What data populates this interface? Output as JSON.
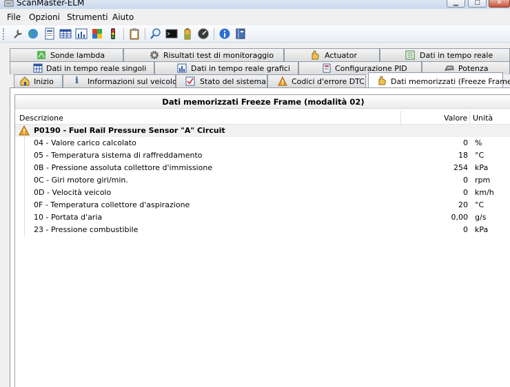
{
  "window": {
    "title": "ScanMaster-ELM"
  },
  "menu": [
    "File",
    "Opzioni",
    "Strumenti",
    "Aiuto"
  ],
  "toolbar_icons": [
    "wrench-icon",
    "globe-icon",
    "document-icon",
    "grid-icon",
    "bar-chart-icon",
    "colorful-window-icon",
    "traffic-light-icon",
    "clipboard-icon",
    "magnifier-icon",
    "terminal-icon",
    "battery-icon",
    "gauge-icon",
    "info-icon",
    "book-icon"
  ],
  "tabs": {
    "row1": [
      "Sonde lambda",
      "Risultati test di monitoraggio",
      "Actuator",
      "Dati in tempo reale"
    ],
    "row2": [
      "Dati in tempo reale singoli",
      "Dati in tempo reale grafici",
      "Configurazione PID",
      "Potenza"
    ],
    "row3": [
      "Inizio",
      "Informazioni sul veicolo",
      "Stato del sistema",
      "Codici d'errore DTC",
      "Dati memorizzati (Freeze Frame)"
    ]
  },
  "freeze_frame": {
    "title": "Dati memorizzati Freeze Frame (modalità 02)",
    "columns": {
      "description": "Descrizione",
      "value": "Valore",
      "unit": "Unità"
    },
    "dtc": "P0190 - Fuel Rail Pressure Sensor \"A\" Circuit",
    "rows": [
      {
        "desc": "04 - Valore carico calcolato",
        "value": "0",
        "unit": "%"
      },
      {
        "desc": "05 - Temperatura sistema di raffreddamento",
        "value": "18",
        "unit": "°C"
      },
      {
        "desc": "0B - Pressione assoluta collettore d'immissione",
        "value": "254",
        "unit": "kPa"
      },
      {
        "desc": "0C - Giri motore giri/min.",
        "value": "0",
        "unit": "rpm"
      },
      {
        "desc": "0D - Velocità veicolo",
        "value": "0",
        "unit": "km/h"
      },
      {
        "desc": "0F - Temperatura collettore d'aspirazione",
        "value": "20",
        "unit": "°C"
      },
      {
        "desc": "10 - Portata d'aria",
        "value": "0,00",
        "unit": "g/s"
      },
      {
        "desc": "23 - Pressione combustibile",
        "value": "0",
        "unit": "kPa"
      }
    ]
  },
  "colors": {
    "warning": "#f0a020",
    "active_tab": "#ffffff",
    "tab": "#e4e4e4"
  }
}
